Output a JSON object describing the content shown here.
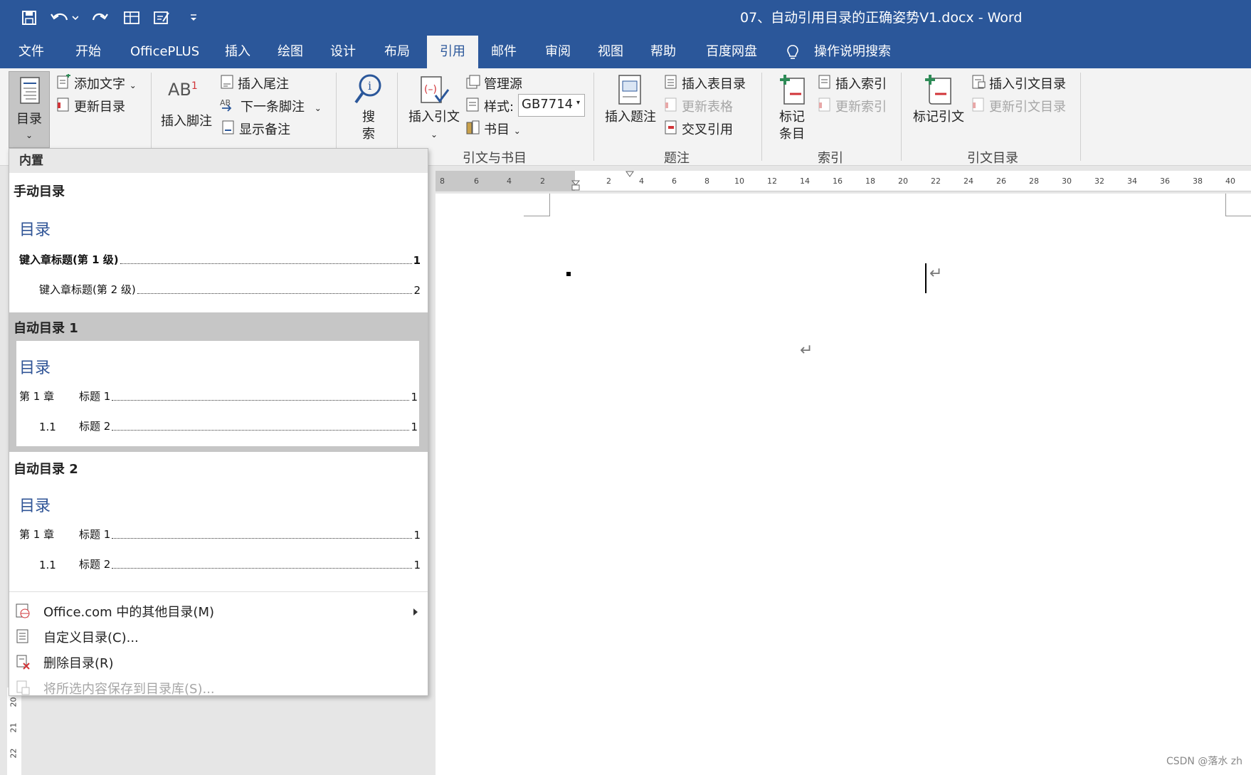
{
  "window": {
    "doc_title": "07、自动引用目录的正确姿势V1.docx  -  Word"
  },
  "tabs": [
    {
      "label": "文件"
    },
    {
      "label": "开始"
    },
    {
      "label": "OfficePLUS"
    },
    {
      "label": "插入"
    },
    {
      "label": "绘图"
    },
    {
      "label": "设计"
    },
    {
      "label": "布局"
    },
    {
      "label": "引用",
      "active": true
    },
    {
      "label": "邮件"
    },
    {
      "label": "审阅"
    },
    {
      "label": "视图"
    },
    {
      "label": "帮助"
    },
    {
      "label": "百度网盘"
    }
  ],
  "tell_me": "操作说明搜索",
  "ribbon": {
    "toc": {
      "label": "目录",
      "add_text": "添加文字",
      "update_toc": "更新目录"
    },
    "footnotes": {
      "insert_footnote": "插入脚注",
      "insert_endnote": "插入尾注",
      "next_footnote": "下一条脚注",
      "show_notes": "显示备注",
      "ab_glyph": "AB",
      "sup_glyph": "1"
    },
    "search": {
      "label_1": "搜",
      "label_2": "索"
    },
    "citations": {
      "insert_citation": "插入引文",
      "manage_sources": "管理源",
      "style_label": "样式:",
      "style_value": "GB7714",
      "bibliography": "书目",
      "group_label": "引文与书目"
    },
    "captions": {
      "insert_caption": "插入题注",
      "insert_table_of_figures": "插入表目录",
      "update_table": "更新表格",
      "cross_reference": "交叉引用",
      "group_label": "题注"
    },
    "index": {
      "mark_entry_1": "标记",
      "mark_entry_2": "条目",
      "insert_index": "插入索引",
      "update_index": "更新索引",
      "group_label": "索引"
    },
    "authorities": {
      "mark_citation": "标记引文",
      "insert_toa": "插入引文目录",
      "update_toa": "更新引文目录",
      "group_label": "引文目录"
    }
  },
  "toc_menu": {
    "builtin_header": "内置",
    "manual": {
      "title": "手动目录",
      "heading": "目录",
      "line1": {
        "text": "键入章标题(第 1 级)",
        "page": "1"
      },
      "line2": {
        "text": "键入章标题(第 2 级)",
        "page": "2"
      }
    },
    "auto1": {
      "title": "自动目录 1",
      "heading": "目录",
      "line1": {
        "num": "第 1 章",
        "text": "标题 1",
        "page": "1"
      },
      "line2": {
        "num": "1.1",
        "text": "标题 2",
        "page": "1"
      }
    },
    "auto2": {
      "title": "自动目录 2",
      "heading": "目录",
      "line1": {
        "num": "第 1 章",
        "text": "标题 1",
        "page": "1"
      },
      "line2": {
        "num": "1.1",
        "text": "标题 2",
        "page": "1"
      }
    },
    "items": {
      "office_more": "Office.com 中的其他目录(M)",
      "custom": "自定义目录(C)...",
      "remove": "删除目录(R)",
      "save_selection": "将所选内容保存到目录库(S)..."
    }
  },
  "ruler": {
    "left_ticks": [
      "8",
      "6",
      "4",
      "2"
    ],
    "right_ticks": [
      "2",
      "4",
      "6",
      "8",
      "10",
      "12",
      "14",
      "16",
      "18",
      "20",
      "22",
      "24",
      "26",
      "28",
      "30",
      "32",
      "34",
      "36",
      "38",
      "40"
    ]
  },
  "vruler": {
    "ticks": [
      "20",
      "21",
      "22"
    ]
  },
  "watermark": "CSDN @落水 zh",
  "colors": {
    "word_blue": "#2b579a",
    "toc_heading": "#2f5496"
  }
}
